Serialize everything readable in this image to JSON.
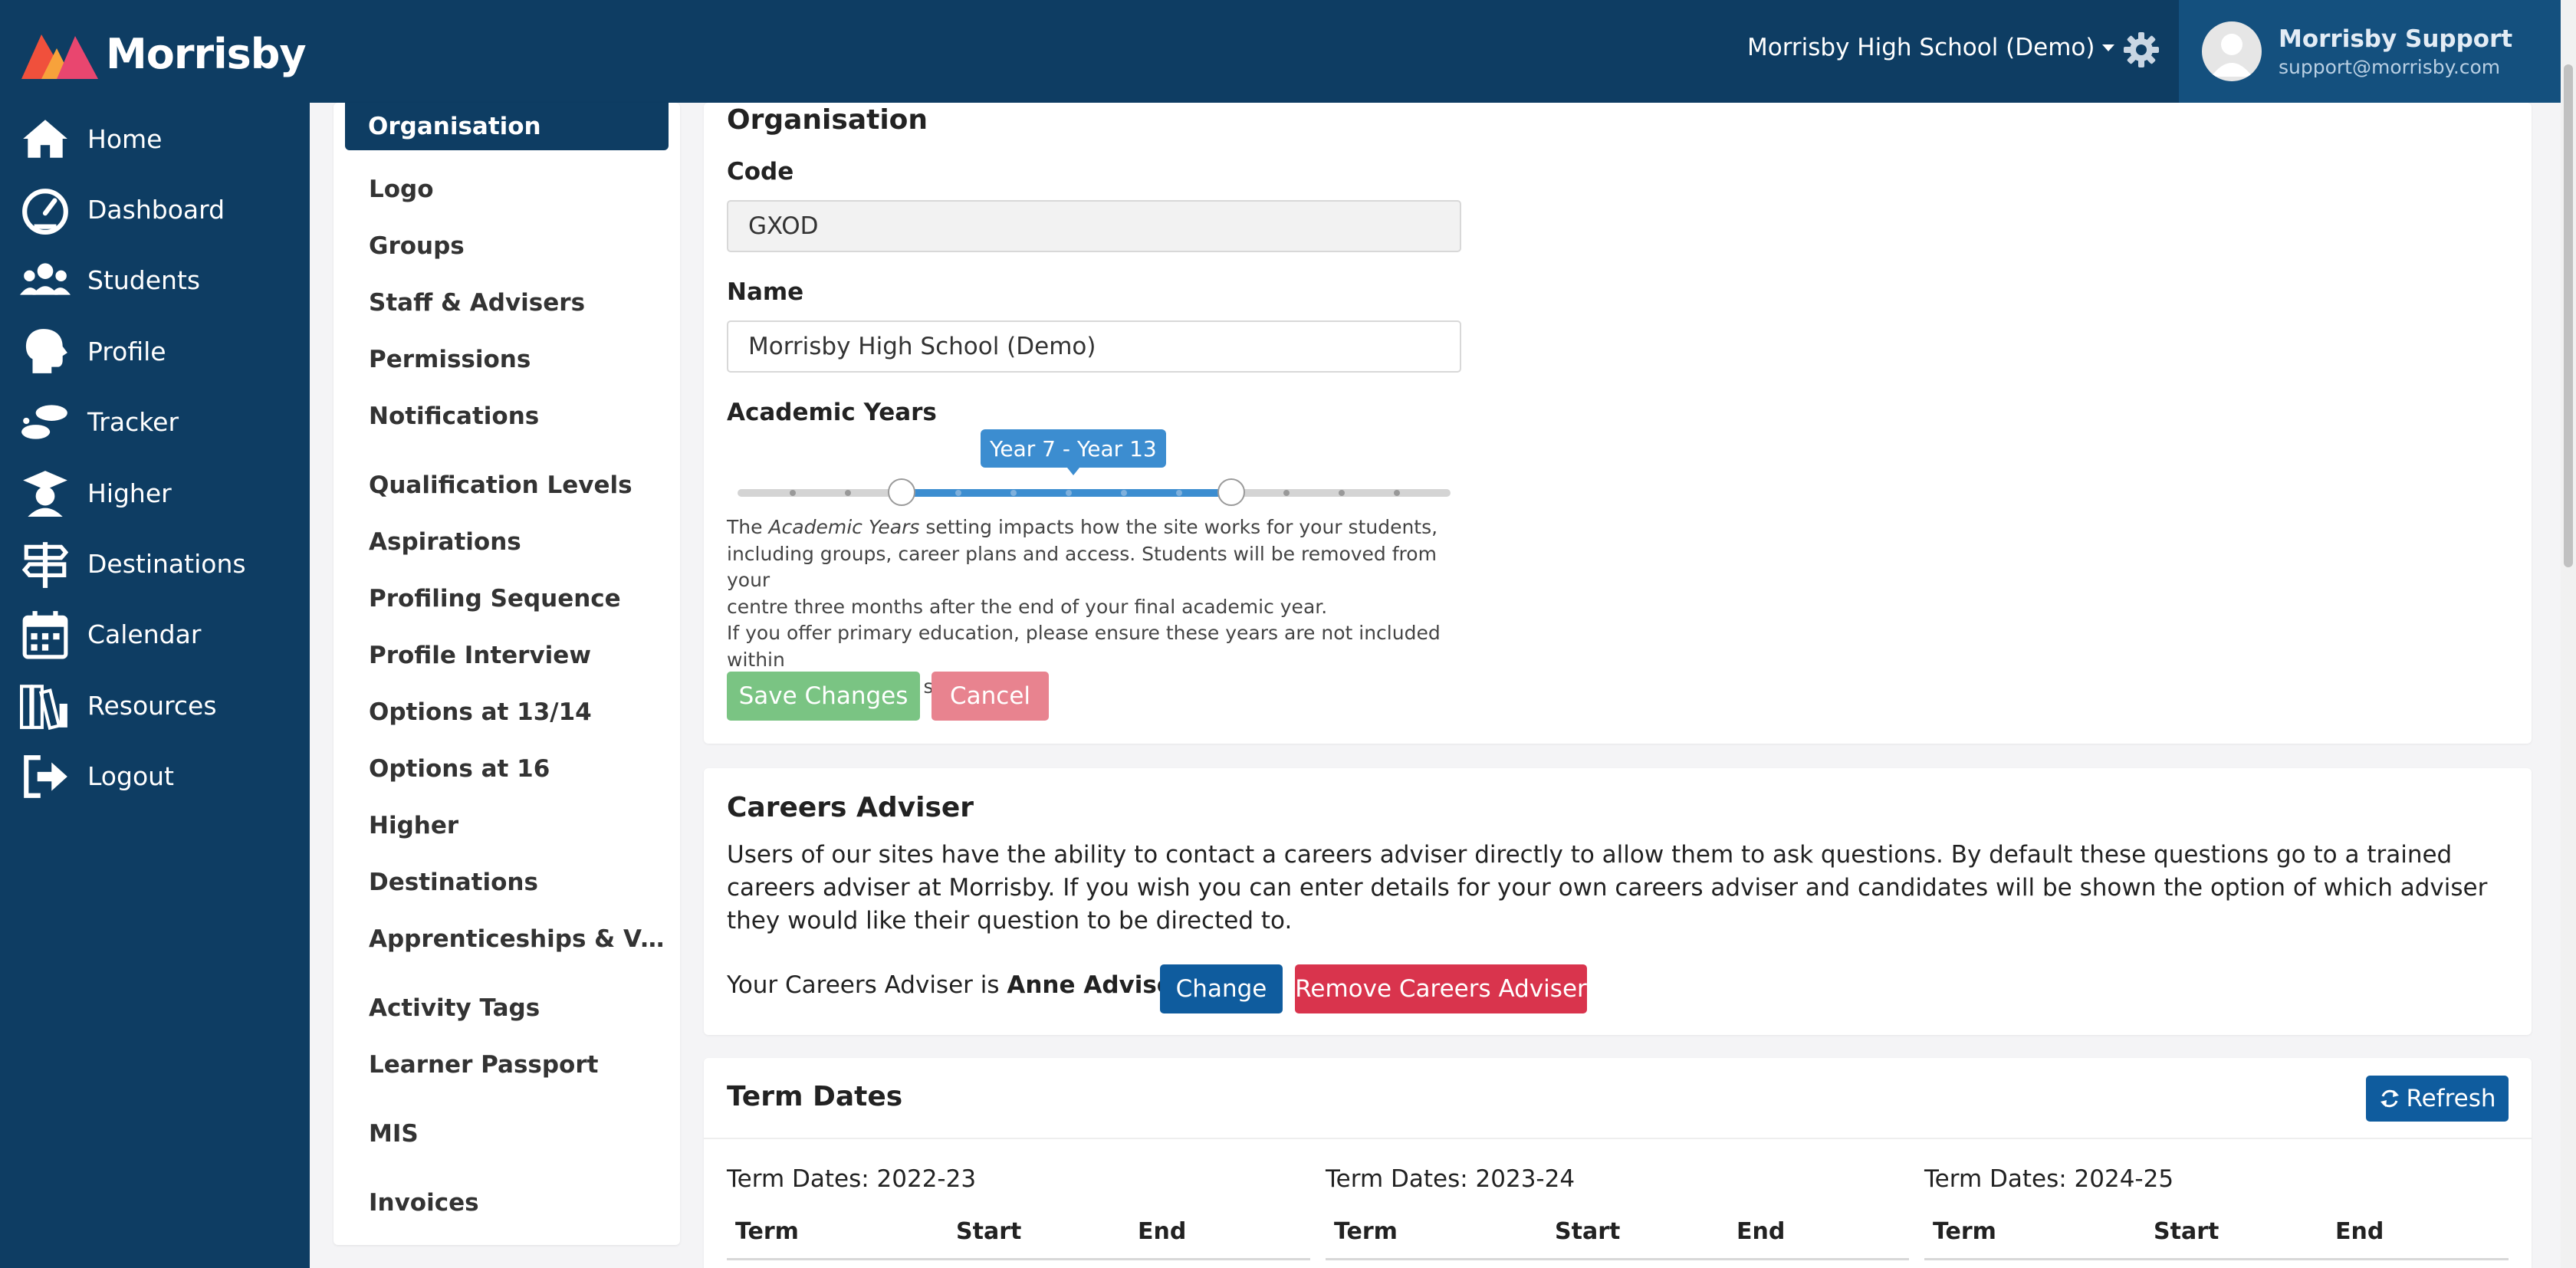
{
  "brand": {
    "name": "Morrisby"
  },
  "nav": {
    "items": [
      {
        "label": "Home",
        "icon": "home-icon"
      },
      {
        "label": "Dashboard",
        "icon": "gauge-icon"
      },
      {
        "label": "Students",
        "icon": "users-icon"
      },
      {
        "label": "Profile",
        "icon": "head-profile-icon"
      },
      {
        "label": "Tracker",
        "icon": "footprints-icon"
      },
      {
        "label": "Higher",
        "icon": "graduation-cap-icon"
      },
      {
        "label": "Destinations",
        "icon": "signpost-icon"
      },
      {
        "label": "Calendar",
        "icon": "calendar-icon"
      },
      {
        "label": "Resources",
        "icon": "books-icon"
      },
      {
        "label": "Logout",
        "icon": "logout-icon"
      }
    ]
  },
  "topbar": {
    "school": "Morrisby High School (Demo)",
    "user_name": "Morrisby Support",
    "user_email": "support@morrisby.com"
  },
  "settings_menu": {
    "active": "Organisation",
    "items": [
      "Logo",
      "Groups",
      "Staff & Advisers",
      "Permissions",
      "Notifications",
      "Qualification Levels",
      "Aspirations",
      "Profiling Sequence",
      "Profile Interview",
      "Options at 13/14",
      "Options at 16",
      "Higher",
      "Destinations",
      "Apprenticeships & Voc...",
      "Activity Tags",
      "Learner Passport",
      "MIS",
      "Invoices"
    ]
  },
  "organisation": {
    "title": "Organisation",
    "code_label": "Code",
    "code_value": "GXOD",
    "name_label": "Name",
    "name_value": "Morrisby High School (Demo)",
    "years_label": "Academic Years",
    "years_range": "Year 7 - Year 13",
    "help_prefix": "The ",
    "help_emph": "Academic Years",
    "help_line1_rest": " setting impacts how the site works for your students,",
    "help_line2": "including groups, career plans and access. Students will be removed from your",
    "help_line3": "centre three months after the end of your final academic year.",
    "help_line4": "If you offer primary education, please ensure these years are not included within",
    "help_line5": "your academic year settings.",
    "save_label": "Save Changes",
    "cancel_label": "Cancel"
  },
  "adviser": {
    "title": "Careers Adviser",
    "paragraph": "Users of our sites have the ability to contact a careers adviser directly to allow them to ask questions. By default these questions go to a trained careers adviser at Morrisby. If you wish you can enter details for your own careers adviser and candidates will be shown the option of which adviser they would like their question to be directed to.",
    "line_prefix": "Your Careers Adviser is ",
    "adviser_name": "Anne Adviser",
    "line_suffix": ".",
    "change_label": "Change",
    "remove_label": "Remove Careers Adviser"
  },
  "terms": {
    "title": "Term Dates",
    "refresh_label": "Refresh",
    "headers": {
      "term": "Term",
      "start": "Start",
      "end": "End"
    },
    "years": [
      "Term Dates: 2022-23",
      "Term Dates: 2023-24",
      "Term Dates: 2024-25"
    ]
  },
  "colors": {
    "navy": "#0e3d63",
    "primary_button": "#0f5c9e",
    "danger_button": "#d9344d",
    "save_disabled": "#7ac483",
    "cancel_disabled": "#e8838f",
    "slider_blue": "#3c8dd0"
  }
}
